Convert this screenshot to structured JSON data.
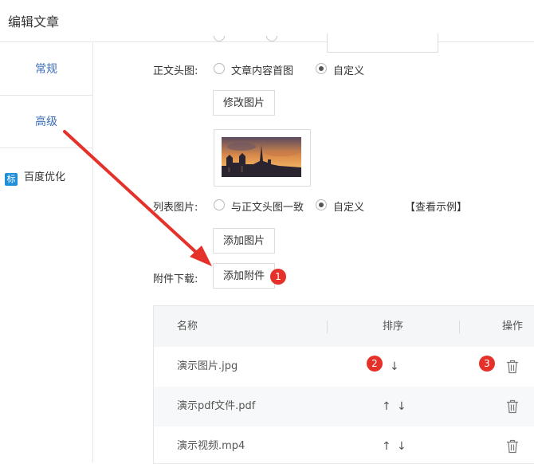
{
  "header": {
    "title": "编辑文章"
  },
  "sidebar": {
    "items": [
      {
        "label": "常规"
      },
      {
        "label": "高级"
      },
      {
        "label": "百度优化",
        "tag": "标"
      }
    ]
  },
  "form": {
    "header_image": {
      "label": "正文头图:",
      "options": [
        "文章内容首图",
        "自定义"
      ],
      "selected": "自定义",
      "button": "修改图片"
    },
    "list_image": {
      "label": "列表图片:",
      "options": [
        "与正文头图一致",
        "自定义"
      ],
      "selected": "自定义",
      "example_link": "【查看示例】",
      "button": "添加图片"
    },
    "attachments": {
      "label": "附件下载:",
      "button": "添加附件"
    }
  },
  "badges": [
    "1",
    "2",
    "3"
  ],
  "table": {
    "columns": [
      "名称",
      "排序",
      "操作"
    ],
    "rows": [
      {
        "name": "演示图片.jpg",
        "sort": [
          "↓"
        ]
      },
      {
        "name": "演示pdf文件.pdf",
        "sort": [
          "↑",
          "↓"
        ]
      },
      {
        "name": "演示视频.mp4",
        "sort": [
          "↑",
          "↓"
        ]
      }
    ]
  },
  "icons": {
    "delete": "trash-icon",
    "thumbnail": "cathedral-image"
  },
  "colors": {
    "accent": "#3a6cb8",
    "badge": "#e4312a",
    "annotation_arrow": "#e4312a",
    "tag": "#1e8fd8"
  }
}
